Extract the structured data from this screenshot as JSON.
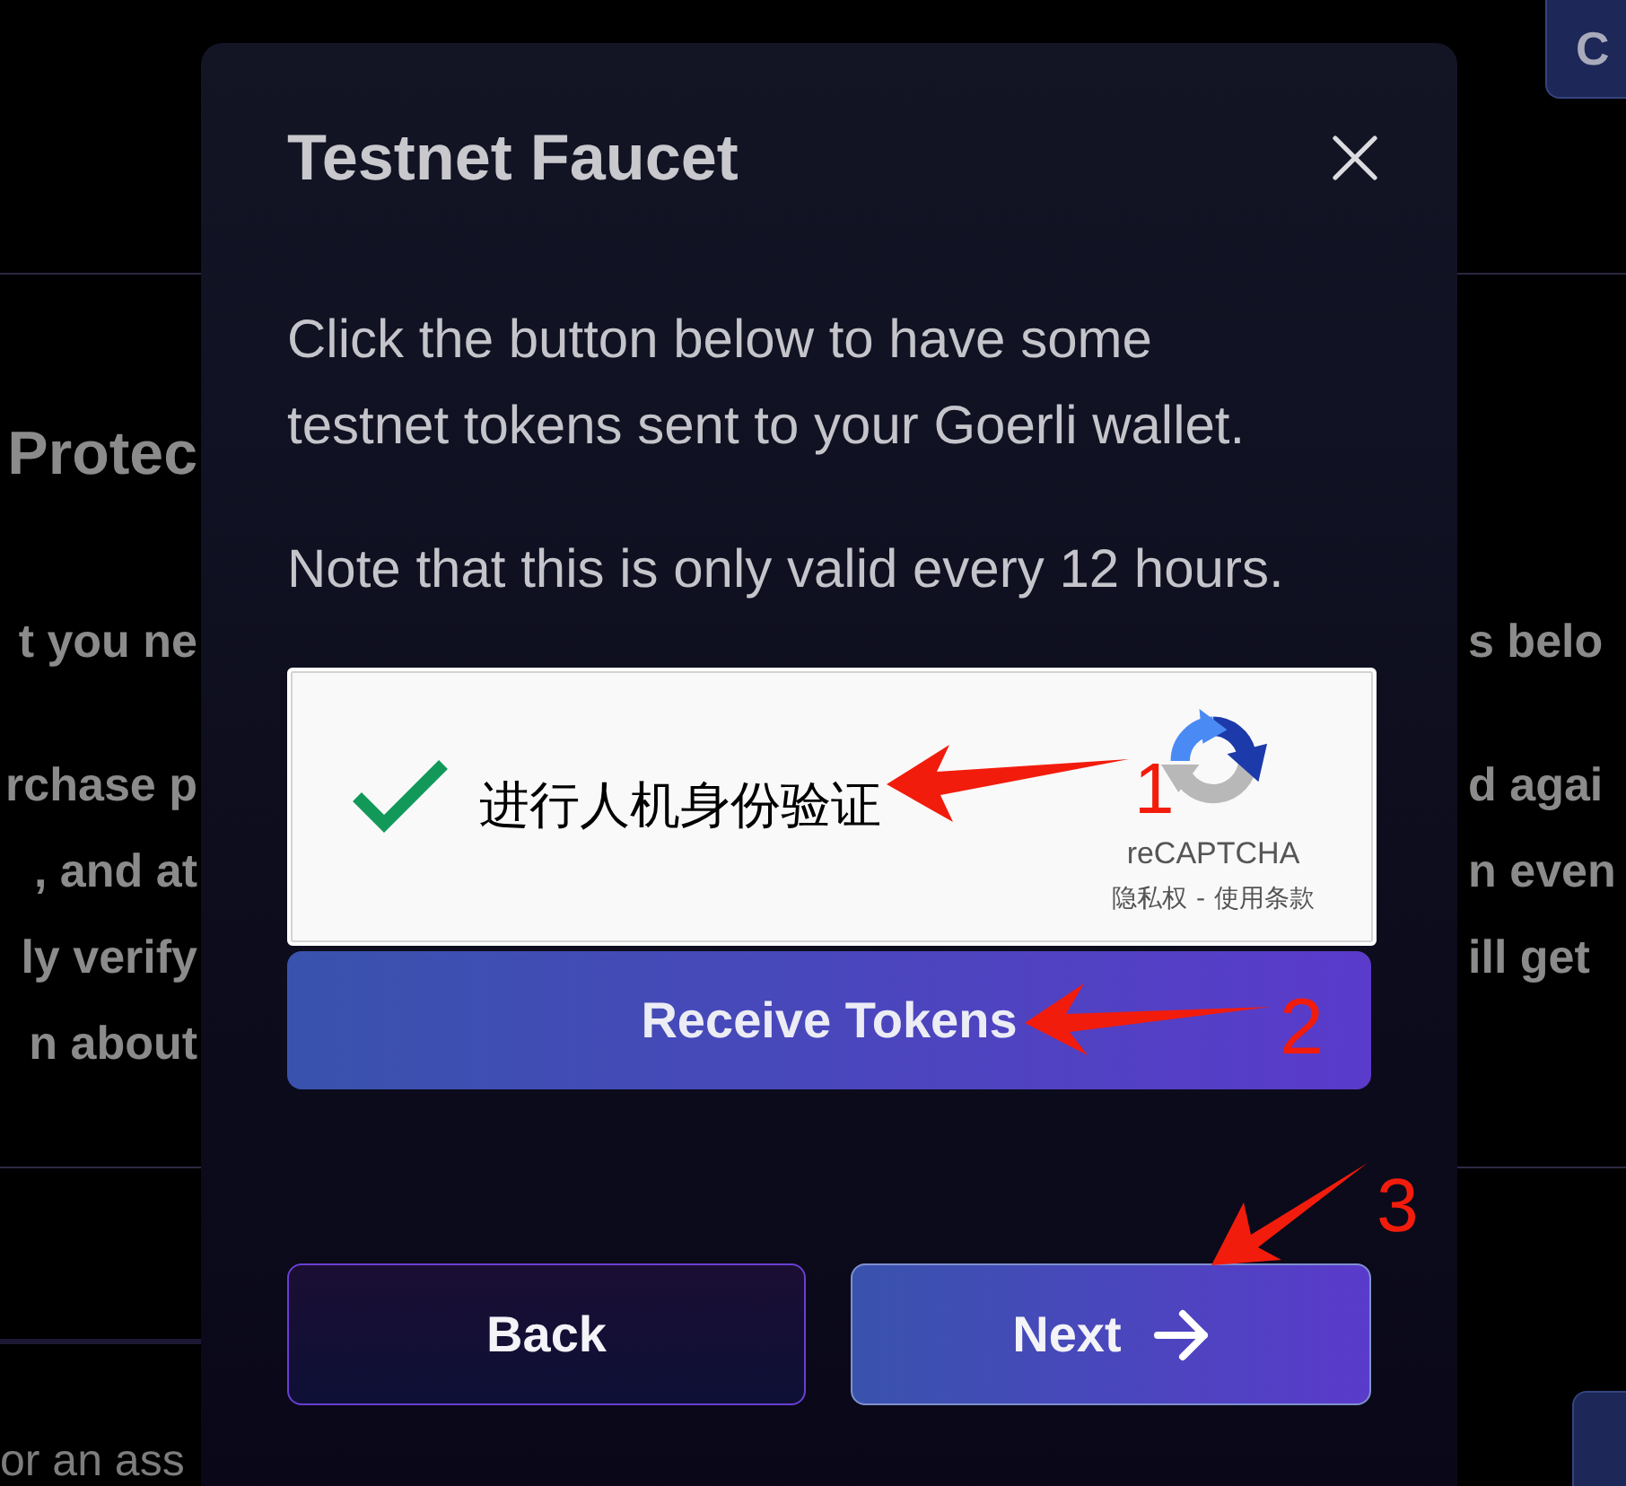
{
  "background_page": {
    "top_button": {
      "label": "C"
    },
    "heading": "Protec",
    "rows": [
      {
        "left": "t you ne",
        "right": "s belo"
      },
      {
        "left": "rchase p",
        "right": "d agai"
      },
      {
        "left": ", and at",
        "right": "n even"
      },
      {
        "left": "ly verify",
        "right": "ill get"
      },
      {
        "left": "n about"
      }
    ],
    "footer_text": "or an ass"
  },
  "dialog": {
    "title": "Testnet Faucet",
    "paragraphs": [
      "Click the button below to have some testnet tokens sent to your Goerli wallet.",
      "Note that this is only valid every 12 hours."
    ],
    "captcha": {
      "checked": true,
      "label": "进行人机身份验证",
      "brand": "reCAPTCHA",
      "privacy_link": "隐私权",
      "separator": "-",
      "terms_link": "使用条款"
    },
    "receive_button": {
      "label": "Receive Tokens"
    },
    "back_button": {
      "label": "Back"
    },
    "next_button": {
      "label": "Next"
    }
  },
  "annotations": [
    {
      "label": "1"
    },
    {
      "label": "2"
    },
    {
      "label": "3"
    }
  ]
}
